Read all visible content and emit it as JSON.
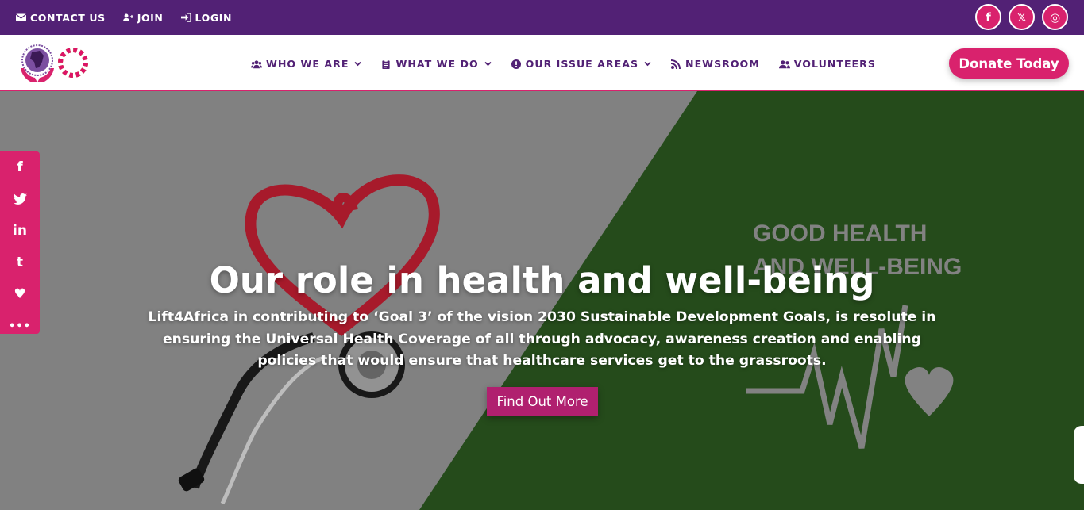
{
  "topbar": {
    "links": [
      {
        "label": "CONTACT US",
        "icon": "envelope-icon"
      },
      {
        "label": "JOIN",
        "icon": "user-plus-icon"
      },
      {
        "label": "LOGIN",
        "icon": "sign-in-icon"
      }
    ],
    "socials": [
      {
        "label": "f",
        "icon": "facebook-icon"
      },
      {
        "label": "𝕏",
        "icon": "x-twitter-icon"
      },
      {
        "label": "◎",
        "icon": "instagram-icon"
      }
    ]
  },
  "nav": {
    "items": [
      {
        "label": "WHO WE ARE",
        "icon": "users-icon",
        "dropdown": true
      },
      {
        "label": "WHAT WE DO",
        "icon": "clipboard-icon",
        "dropdown": true
      },
      {
        "label": "OUR ISSUE AREAS",
        "icon": "info-circle-icon",
        "dropdown": true
      },
      {
        "label": "NEWSROOM",
        "icon": "rss-icon",
        "dropdown": false
      },
      {
        "label": "VOLUNTEERS",
        "icon": "user-friends-icon",
        "dropdown": false
      }
    ],
    "donate_label": "Donate Today"
  },
  "share": {
    "buttons": [
      {
        "label": "f",
        "icon": "facebook-icon"
      },
      {
        "label": "🐦",
        "icon": "twitter-icon"
      },
      {
        "label": "in",
        "icon": "linkedin-icon"
      },
      {
        "label": "t",
        "icon": "tumblr-icon"
      },
      {
        "label": "♥",
        "icon": "heart-icon"
      },
      {
        "label": "•••",
        "icon": "more-icon"
      }
    ]
  },
  "hero": {
    "title": "Our role in health and well-being",
    "text": "Lift4Africa in contributing to ‘Goal 3’ of the vision 2030 Sustainable Development Goals, is resolute in ensuring the Universal Health Coverage of all through advocacy, awareness creation and enabling policies that would ensure that healthcare services get to the grassroots.",
    "cta_label": "Find Out More",
    "sdg_line1": "GOOD HEALTH",
    "sdg_line2": "AND WELL-BEING"
  },
  "colors": {
    "purple": "#522175",
    "pink": "#d9226d",
    "green": "#27501d",
    "grey": "#888888"
  }
}
